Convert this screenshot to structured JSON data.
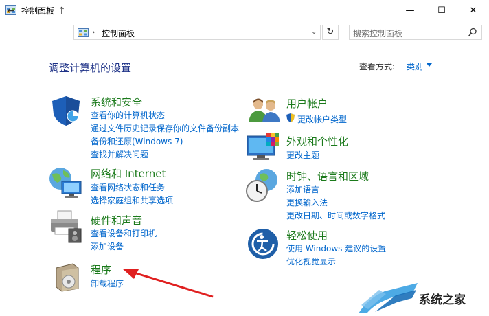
{
  "window": {
    "title": "控制面板",
    "minimize": "—",
    "maximize": "☐",
    "close": "✕"
  },
  "nav": {
    "back": "←",
    "forward": "→",
    "recent": "⌄",
    "up": "↑",
    "address_sep": "›",
    "address_text": "控制面板",
    "address_drop": "⌄",
    "refresh": "↻",
    "search_placeholder": "搜索控制面板"
  },
  "header": {
    "heading": "调整计算机的设置",
    "view_by_label": "查看方式:",
    "view_by_value": "类别"
  },
  "categories": [
    {
      "title": "系统和安全",
      "links": [
        "查看你的计算机状态",
        "通过文件历史记录保存你的文件备份副本",
        "备份和还原(Windows 7)",
        "查找并解决问题"
      ]
    },
    {
      "title": "网络和 Internet",
      "links": [
        "查看网络状态和任务",
        "选择家庭组和共享选项"
      ]
    },
    {
      "title": "硬件和声音",
      "links": [
        "查看设备和打印机",
        "添加设备"
      ]
    },
    {
      "title": "程序",
      "links": [
        "卸载程序"
      ]
    },
    {
      "title": "用户帐户",
      "links": [
        "更改帐户类型"
      ]
    },
    {
      "title": "外观和个性化",
      "links": [
        "更改主题"
      ]
    },
    {
      "title": "时钟、语言和区域",
      "links": [
        "添加语言",
        "更换输入法",
        "更改日期、时间或数字格式"
      ]
    },
    {
      "title": "轻松使用",
      "links": [
        "使用 Windows 建议的设置",
        "优化视觉显示"
      ]
    }
  ],
  "watermark": {
    "text": "系统之家"
  },
  "colors": {
    "title_green": "#1b7a1b",
    "link_blue": "#0066cc",
    "heading_blue": "#1e3287",
    "arrow_red": "#e02020"
  }
}
